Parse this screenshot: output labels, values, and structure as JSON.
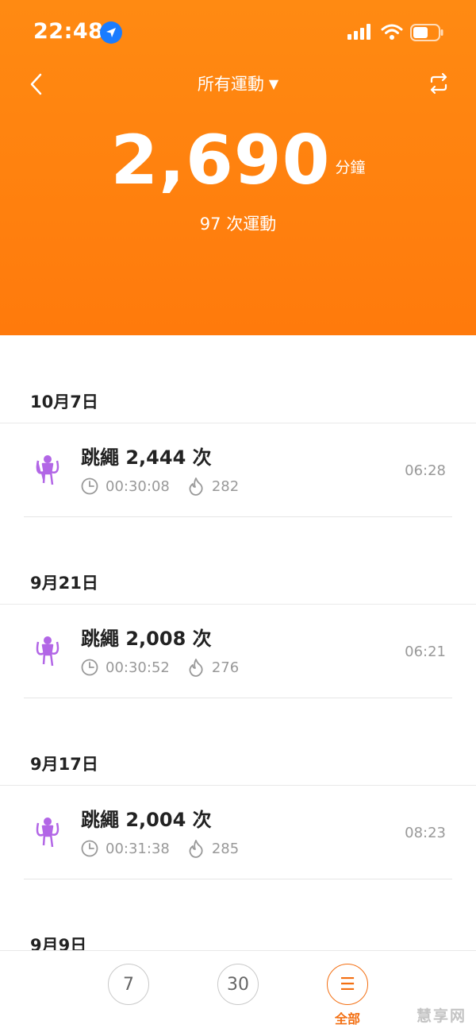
{
  "status": {
    "time": "22:48"
  },
  "nav": {
    "title": "所有運動",
    "caret": "▼"
  },
  "summary": {
    "total_minutes": "2,690",
    "unit": "分鐘",
    "workout_count": "97 次運動"
  },
  "colors": {
    "accent": "#ff8a12",
    "icon_purple": "#b266e6",
    "tab_active": "#f36f12"
  },
  "sections": [
    {
      "date": "10月7日",
      "entry": {
        "title": "跳繩 2,444 次",
        "duration": "00:30:08",
        "calories": "282",
        "time": "06:28"
      }
    },
    {
      "date": "9月21日",
      "entry": {
        "title": "跳繩 2,008 次",
        "duration": "00:30:52",
        "calories": "276",
        "time": "06:21"
      }
    },
    {
      "date": "9月17日",
      "entry": {
        "title": "跳繩 2,004 次",
        "duration": "00:31:38",
        "calories": "285",
        "time": "08:23"
      }
    },
    {
      "date": "9月9日"
    }
  ],
  "tabs": [
    {
      "label": "7"
    },
    {
      "label": "30"
    },
    {
      "label": "☰",
      "caption": "全部"
    }
  ],
  "icons": [
    "location-arrow-icon",
    "signal-icon",
    "wifi-icon",
    "battery-icon",
    "back-chevron-icon",
    "sync-icon",
    "jump-rope-icon",
    "clock-icon",
    "flame-icon",
    "list-icon"
  ],
  "watermark": "慧享网"
}
